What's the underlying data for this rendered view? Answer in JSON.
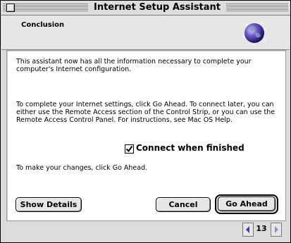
{
  "window": {
    "title": "Internet Setup Assistant"
  },
  "header": {
    "title": "Conclusion",
    "icon": "globe-icon"
  },
  "content": {
    "paragraph1": "This assistant now has all the information necessary to complete your computer's Internet configuration.",
    "paragraph2": "To complete your Internet settings, click Go Ahead.  To connect later, you can either use the Remote Access section of the Control Strip, or you can use the Remote Access Control Panel.  For instructions, see Mac OS Help.",
    "checkbox": {
      "label": "Connect when finished",
      "checked": true
    },
    "paragraph3": "To make your changes, click Go Ahead."
  },
  "buttons": {
    "show_details": "Show Details",
    "cancel": "Cancel",
    "go_ahead": "Go Ahead"
  },
  "pager": {
    "count": "13"
  }
}
